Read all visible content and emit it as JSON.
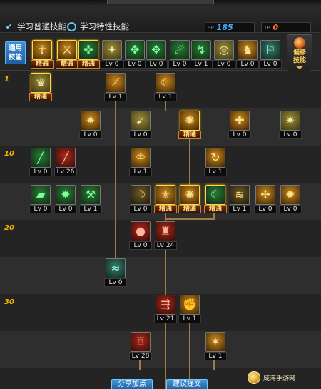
{
  "header": {
    "radio_common_label": "学习普通技能",
    "radio_special_label": "学习特性技能",
    "sp_tag": "SP",
    "sp_value": "185",
    "tp_tag": "TP",
    "tp_value": "0"
  },
  "general_bar": {
    "label": "通用\n技能",
    "expand_label": "偏移\n技能",
    "skills": [
      {
        "icon": "☥",
        "lv": "精通",
        "master": true,
        "theme": "th-gold"
      },
      {
        "icon": "⚔",
        "lv": "精通",
        "master": true,
        "theme": "th-gold"
      },
      {
        "icon": "✜",
        "lv": "精通",
        "master": true,
        "theme": "th-green"
      },
      {
        "icon": "✦",
        "lv": "Lv 0",
        "master": false,
        "theme": "th-olive"
      },
      {
        "icon": "✥",
        "lv": "Lv 0",
        "master": false,
        "theme": "th-green"
      },
      {
        "icon": "✥",
        "lv": "Lv 0",
        "master": false,
        "theme": "th-green"
      },
      {
        "icon": "☄",
        "lv": "Lv 0",
        "master": false,
        "theme": "th-green"
      },
      {
        "icon": "↯",
        "lv": "Lv 1",
        "master": false,
        "theme": "th-green"
      },
      {
        "icon": "◎",
        "lv": "Lv 0",
        "master": false,
        "theme": "th-olive"
      },
      {
        "icon": "♞",
        "lv": "Lv 0",
        "master": false,
        "theme": "th-gold"
      },
      {
        "icon": "⚐",
        "lv": "Lv 0",
        "master": false,
        "theme": "th-teal"
      }
    ]
  },
  "tree": {
    "level_marks": [
      "1",
      "10",
      "20",
      "30"
    ],
    "rows": [
      [
        {
          "col": 43,
          "icon": "♛",
          "lv": "精通",
          "master": true,
          "theme": "th-olive"
        },
        {
          "col": 148,
          "icon": "⟋",
          "lv": "Lv 1",
          "master": false,
          "theme": "th-gold"
        },
        {
          "col": 218,
          "icon": "☾",
          "lv": "Lv 1",
          "master": false,
          "theme": "th-gold"
        }
      ],
      [
        {
          "col": 113,
          "icon": "✷",
          "lv": "Lv 0",
          "master": false,
          "theme": "th-gold"
        },
        {
          "col": 183,
          "icon": "➹",
          "lv": "Lv 0",
          "master": false,
          "theme": "th-olive"
        },
        {
          "col": 252,
          "icon": "✺",
          "lv": "精通",
          "master": true,
          "theme": "th-gold"
        },
        {
          "col": 322,
          "icon": "✚",
          "lv": "Lv 0",
          "master": false,
          "theme": "th-gold"
        },
        {
          "col": 393,
          "icon": "✷",
          "lv": "Lv 0",
          "master": false,
          "theme": "th-olive"
        }
      ],
      [
        {
          "col": 43,
          "icon": "╱",
          "lv": "Lv 0",
          "master": false,
          "theme": "th-green"
        },
        {
          "col": 78,
          "icon": "╱",
          "lv": "Lv 26",
          "master": false,
          "theme": "th-red"
        },
        {
          "col": 183,
          "icon": "♔",
          "lv": "Lv 1",
          "master": false,
          "theme": "th-gold"
        },
        {
          "col": 288,
          "icon": "↻",
          "lv": "Lv 1",
          "master": false,
          "theme": "th-gold"
        }
      ],
      [
        {
          "col": 43,
          "icon": "▰",
          "lv": "Lv 0",
          "master": false,
          "theme": "th-green"
        },
        {
          "col": 78,
          "icon": "✸",
          "lv": "Lv 0",
          "master": false,
          "theme": "th-green"
        },
        {
          "col": 113,
          "icon": "⚒",
          "lv": "Lv 1",
          "master": false,
          "theme": "th-green"
        },
        {
          "col": 183,
          "icon": "☽",
          "lv": "Lv 0",
          "master": false,
          "theme": "th-dark"
        },
        {
          "col": 218,
          "icon": "⚜",
          "lv": "精通",
          "master": true,
          "theme": "th-gold"
        },
        {
          "col": 252,
          "icon": "✺",
          "lv": "精通",
          "master": true,
          "theme": "th-gold"
        },
        {
          "col": 288,
          "icon": "☾",
          "lv": "精通",
          "master": true,
          "theme": "th-green"
        },
        {
          "col": 322,
          "icon": "≋",
          "lv": "Lv 1",
          "master": false,
          "theme": "th-dark"
        },
        {
          "col": 358,
          "icon": "✢",
          "lv": "Lv 0",
          "master": false,
          "theme": "th-gold"
        },
        {
          "col": 393,
          "icon": "✹",
          "lv": "Lv 0",
          "master": false,
          "theme": "th-gold"
        }
      ],
      [
        {
          "col": 183,
          "icon": "●",
          "lv": "Lv 0",
          "master": false,
          "theme": "th-red"
        },
        {
          "col": 218,
          "icon": "♜",
          "lv": "Lv 24",
          "master": false,
          "theme": "th-red"
        }
      ],
      [
        {
          "col": 148,
          "icon": "≈",
          "lv": "Lv 0",
          "master": false,
          "theme": "th-teal"
        }
      ],
      [
        {
          "col": 218,
          "icon": "⇶",
          "lv": "Lv 21",
          "master": false,
          "theme": "th-red"
        },
        {
          "col": 252,
          "icon": "✊",
          "lv": "Lv 1",
          "master": false,
          "theme": "th-gold"
        }
      ],
      [
        {
          "col": 183,
          "icon": "♖",
          "lv": "Lv 28",
          "master": false,
          "theme": "th-red"
        },
        {
          "col": 288,
          "icon": "✶",
          "lv": "Lv 1",
          "master": false,
          "theme": "th-gold"
        }
      ]
    ]
  },
  "buttons": {
    "share_label": "分享加点",
    "suggest_label": "建议提交"
  },
  "watermark_text": "威海手游网"
}
